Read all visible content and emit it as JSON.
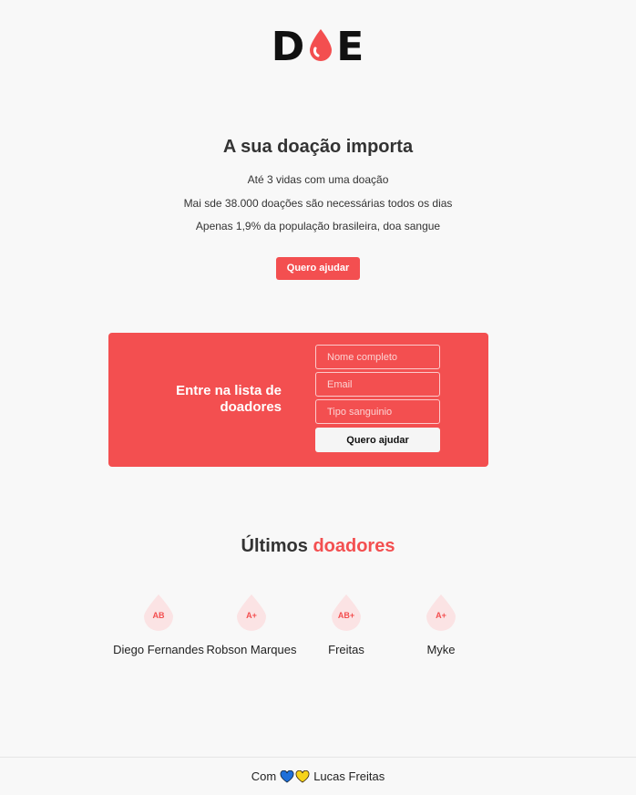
{
  "logo": {
    "text_left": "D",
    "text_right": "E"
  },
  "hero": {
    "title": "A sua doação importa",
    "lines": [
      "Até 3 vidas com uma doação",
      "Mai sde 38.000 doações são necessárias todos os dias",
      "Apenas 1,9% da população brasileira, doa sangue"
    ],
    "cta_label": "Quero ajudar"
  },
  "signup": {
    "title_line1": "Entre na lista de",
    "title_line2": "doadores",
    "name_placeholder": "Nome completo",
    "email_placeholder": "Email",
    "blood_placeholder": "Tipo sanguinio",
    "submit_label": "Quero ajudar"
  },
  "donors_section": {
    "title_plain": "Últimos",
    "title_accent": "doadores",
    "donors": [
      {
        "name": "Diego Fernandes",
        "blood": "AB"
      },
      {
        "name": "Robson Marques",
        "blood": "A+"
      },
      {
        "name": "Freitas",
        "blood": "AB+"
      },
      {
        "name": "Myke",
        "blood": "A+"
      }
    ]
  },
  "footer": {
    "prefix": "Com",
    "author": "Lucas Freitas",
    "hearts": [
      "blue-heart-icon",
      "yellow-heart-icon"
    ]
  },
  "colors": {
    "accent": "#f34f50",
    "badge_bg": "#fbe3e4",
    "background": "#f8f8f8"
  }
}
